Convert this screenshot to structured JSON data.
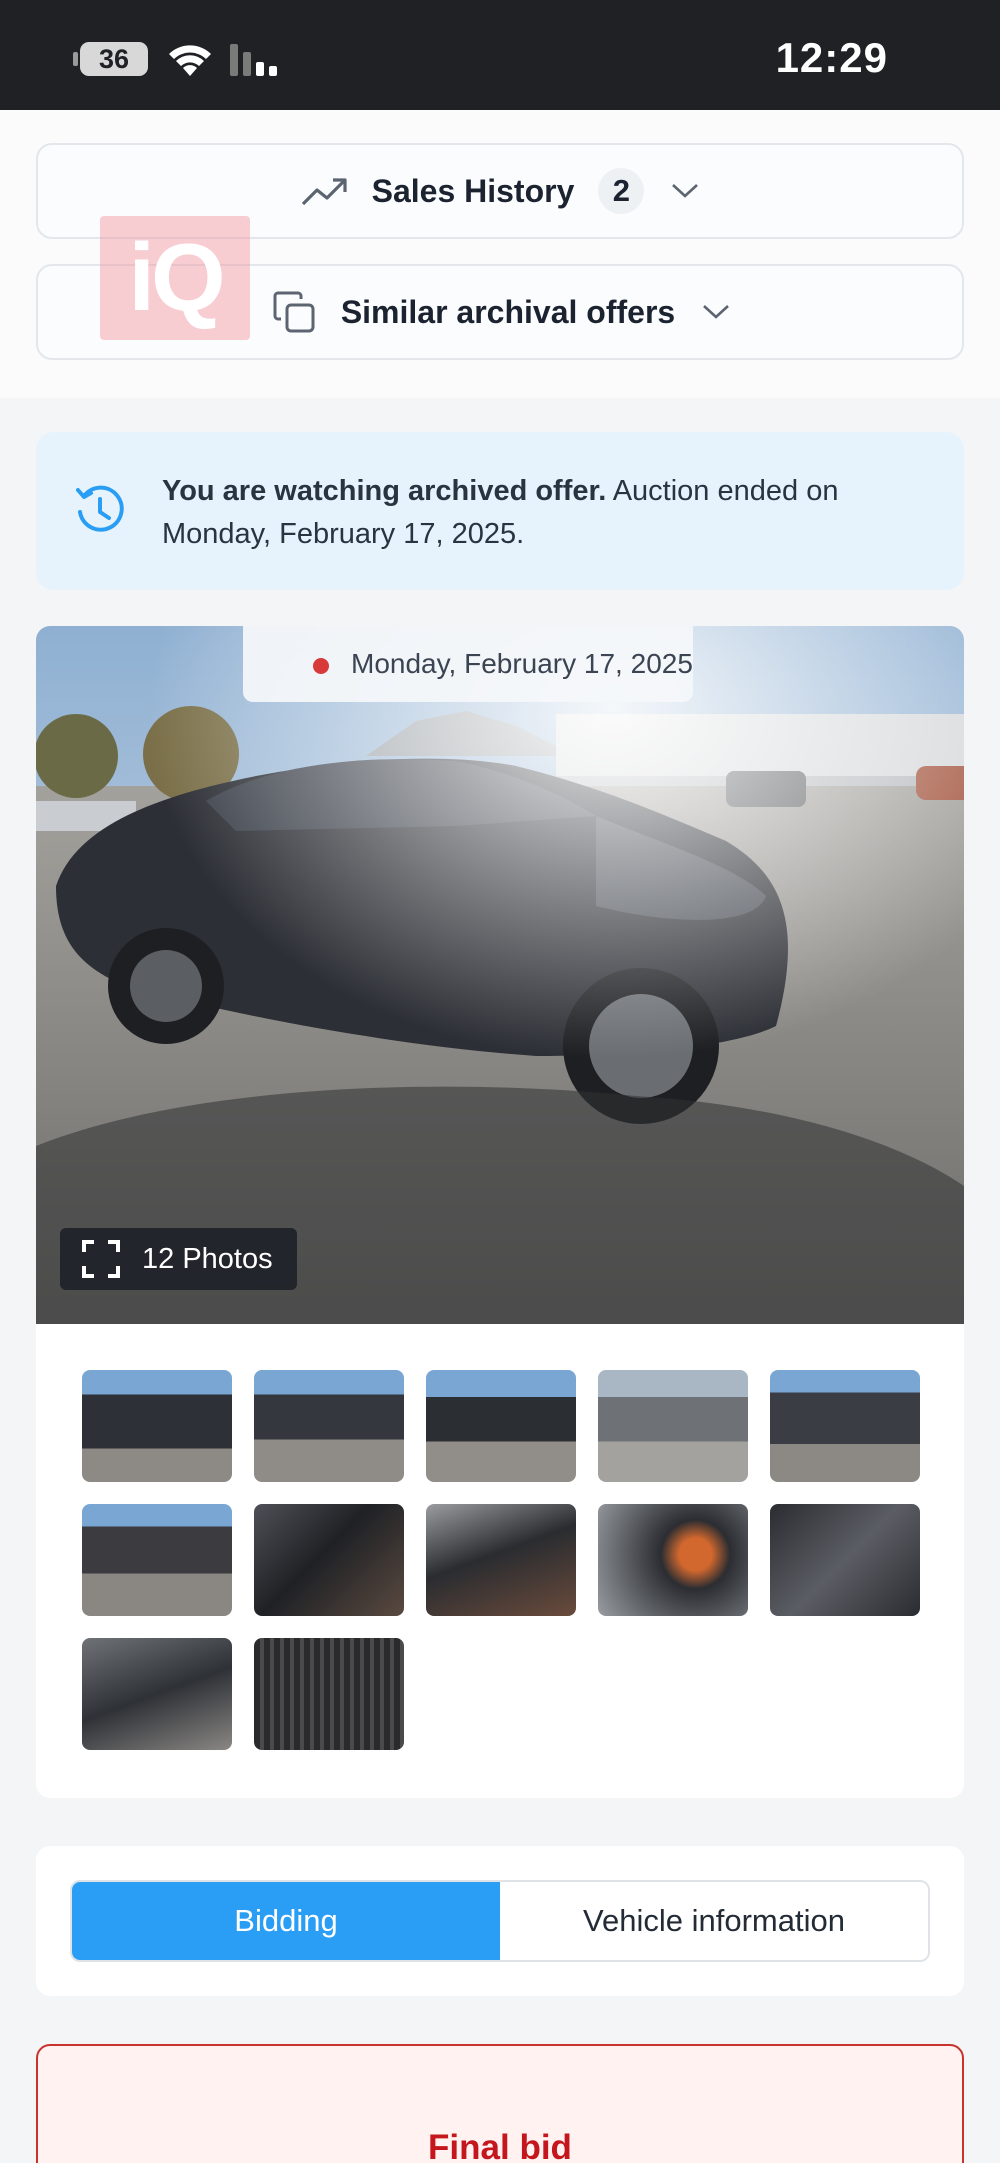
{
  "status_bar": {
    "battery": "36",
    "time": "12:29"
  },
  "watermark": {
    "text": "iQ"
  },
  "sales_history": {
    "label": "Sales History",
    "count": "2"
  },
  "similar_offers": {
    "label": "Similar archival offers"
  },
  "notice": {
    "bold": "You are watching archived offer.",
    "text": " Auction ended on Monday, February 17, 2025."
  },
  "gallery": {
    "date": "Monday, February 17, 2025",
    "photos_label": "12 Photos",
    "thumbnails": [
      "Front quarter damage view",
      "Side view with shadow",
      "Rear side view",
      "Side view in sunlight",
      "Front view damage",
      "Rear view",
      "Driver seat interior",
      "Dashboard interior",
      "Instrument cluster",
      "Rear seat interior",
      "Engine bay",
      "VIN label"
    ]
  },
  "tabs": {
    "bidding": "Bidding",
    "vehicle_info": "Vehicle information"
  },
  "final_bid": {
    "label": "Final bid"
  },
  "colors": {
    "accent": "#2a9df4",
    "danger": "#c4161c",
    "notice_bg": "#e6f3fc"
  }
}
